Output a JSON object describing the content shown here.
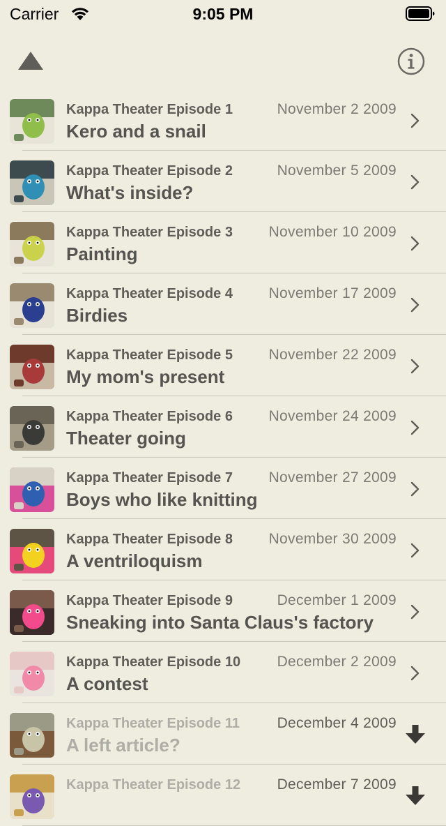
{
  "status_bar": {
    "carrier": "Carrier",
    "time": "9:05 PM"
  },
  "nav": {
    "up_icon": "triangle-up-icon",
    "info_icon": "info-circle-icon"
  },
  "episodes": [
    {
      "title": "Kappa Theater Episode 1",
      "date": "November 2 2009",
      "subtitle": "Kero and a snail",
      "accessory": "chevron-right-icon",
      "thumb_colors": [
        "#6e8a5a",
        "#8fbf4a",
        "#e8e4d8"
      ]
    },
    {
      "title": "Kappa Theater Episode 2",
      "date": "November 5 2009",
      "subtitle": "What's inside?",
      "accessory": "chevron-right-icon",
      "thumb_colors": [
        "#3d4a4e",
        "#2f8fb5",
        "#c9c6b8"
      ]
    },
    {
      "title": "Kappa Theater Episode 3",
      "date": "November 10 2009",
      "subtitle": "Painting",
      "accessory": "chevron-right-icon",
      "thumb_colors": [
        "#8c7a5c",
        "#c9d24a",
        "#e9e4da"
      ]
    },
    {
      "title": "Kappa Theater Episode 4",
      "date": "November 17 2009",
      "subtitle": "Birdies",
      "accessory": "chevron-right-icon",
      "thumb_colors": [
        "#9a8a70",
        "#2a3f8f",
        "#e7e3d7"
      ]
    },
    {
      "title": "Kappa Theater Episode 5",
      "date": "November 22 2009",
      "subtitle": "My mom's present",
      "accessory": "chevron-right-icon",
      "thumb_colors": [
        "#6d3a2c",
        "#a83a3a",
        "#c7b9a4"
      ]
    },
    {
      "title": "Kappa Theater Episode 6",
      "date": "November 24 2009",
      "subtitle": "Theater going",
      "accessory": "chevron-right-icon",
      "thumb_colors": [
        "#6a6457",
        "#3a3a36",
        "#a49c86"
      ]
    },
    {
      "title": "Kappa Theater Episode 7",
      "date": "November 27 2009",
      "subtitle": "Boys who like knitting",
      "accessory": "chevron-right-icon",
      "thumb_colors": [
        "#d8d2c6",
        "#2f5fb0",
        "#d8509a"
      ]
    },
    {
      "title": "Kappa Theater Episode 8",
      "date": "November 30 2009",
      "subtitle": "A ventriloquism",
      "accessory": "chevron-right-icon",
      "thumb_colors": [
        "#5d5446",
        "#f2d21f",
        "#e64a7a"
      ]
    },
    {
      "title": "Kappa Theater Episode 9",
      "date": "December 1 2009",
      "subtitle": "Sneaking into Santa Claus's factory",
      "accessory": "chevron-right-icon",
      "thumb_colors": [
        "#7a5a4a",
        "#f24a8a",
        "#3a2a2a"
      ]
    },
    {
      "title": "Kappa Theater Episode 10",
      "date": "December 2 2009",
      "subtitle": "A contest",
      "accessory": "chevron-right-icon",
      "thumb_colors": [
        "#e6c8c6",
        "#f08aa8",
        "#e9e4de"
      ]
    },
    {
      "title": "Kappa Theater Episode 11",
      "date": "December 4 2009",
      "subtitle": "A left article?",
      "accessory": "download-arrow-icon",
      "thumb_colors": [
        "#9a9a86",
        "#c8c4a8",
        "#7a5a3a"
      ]
    },
    {
      "title": "Kappa Theater Episode 12",
      "date": "December 7 2009",
      "subtitle": "",
      "accessory": "download-arrow-icon",
      "thumb_colors": [
        "#c8a050",
        "#7a5ab0",
        "#e8e0c8"
      ]
    }
  ]
}
